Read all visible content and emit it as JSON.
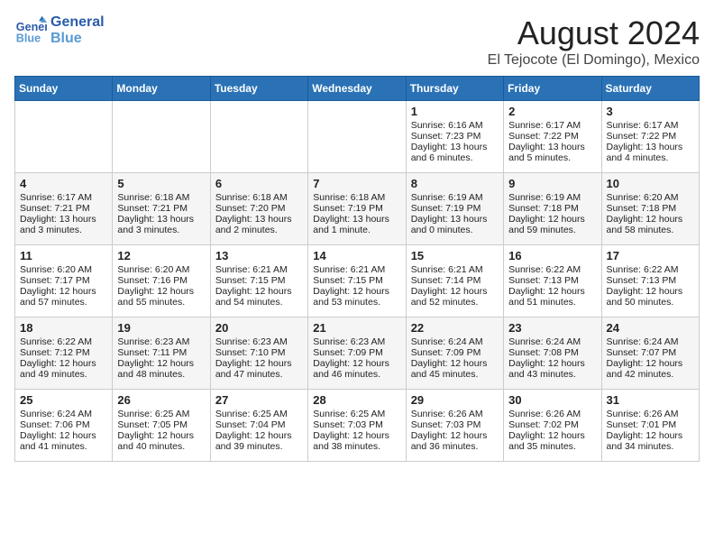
{
  "header": {
    "logo_line1": "General",
    "logo_line2": "Blue",
    "title": "August 2024",
    "subtitle": "El Tejocote (El Domingo), Mexico"
  },
  "days_of_week": [
    "Sunday",
    "Monday",
    "Tuesday",
    "Wednesday",
    "Thursday",
    "Friday",
    "Saturday"
  ],
  "weeks": [
    [
      {
        "day": "",
        "content": ""
      },
      {
        "day": "",
        "content": ""
      },
      {
        "day": "",
        "content": ""
      },
      {
        "day": "",
        "content": ""
      },
      {
        "day": "1",
        "content": "Sunrise: 6:16 AM\nSunset: 7:23 PM\nDaylight: 13 hours\nand 6 minutes."
      },
      {
        "day": "2",
        "content": "Sunrise: 6:17 AM\nSunset: 7:22 PM\nDaylight: 13 hours\nand 5 minutes."
      },
      {
        "day": "3",
        "content": "Sunrise: 6:17 AM\nSunset: 7:22 PM\nDaylight: 13 hours\nand 4 minutes."
      }
    ],
    [
      {
        "day": "4",
        "content": "Sunrise: 6:17 AM\nSunset: 7:21 PM\nDaylight: 13 hours\nand 3 minutes."
      },
      {
        "day": "5",
        "content": "Sunrise: 6:18 AM\nSunset: 7:21 PM\nDaylight: 13 hours\nand 3 minutes."
      },
      {
        "day": "6",
        "content": "Sunrise: 6:18 AM\nSunset: 7:20 PM\nDaylight: 13 hours\nand 2 minutes."
      },
      {
        "day": "7",
        "content": "Sunrise: 6:18 AM\nSunset: 7:19 PM\nDaylight: 13 hours\nand 1 minute."
      },
      {
        "day": "8",
        "content": "Sunrise: 6:19 AM\nSunset: 7:19 PM\nDaylight: 13 hours\nand 0 minutes."
      },
      {
        "day": "9",
        "content": "Sunrise: 6:19 AM\nSunset: 7:18 PM\nDaylight: 12 hours\nand 59 minutes."
      },
      {
        "day": "10",
        "content": "Sunrise: 6:20 AM\nSunset: 7:18 PM\nDaylight: 12 hours\nand 58 minutes."
      }
    ],
    [
      {
        "day": "11",
        "content": "Sunrise: 6:20 AM\nSunset: 7:17 PM\nDaylight: 12 hours\nand 57 minutes."
      },
      {
        "day": "12",
        "content": "Sunrise: 6:20 AM\nSunset: 7:16 PM\nDaylight: 12 hours\nand 55 minutes."
      },
      {
        "day": "13",
        "content": "Sunrise: 6:21 AM\nSunset: 7:15 PM\nDaylight: 12 hours\nand 54 minutes."
      },
      {
        "day": "14",
        "content": "Sunrise: 6:21 AM\nSunset: 7:15 PM\nDaylight: 12 hours\nand 53 minutes."
      },
      {
        "day": "15",
        "content": "Sunrise: 6:21 AM\nSunset: 7:14 PM\nDaylight: 12 hours\nand 52 minutes."
      },
      {
        "day": "16",
        "content": "Sunrise: 6:22 AM\nSunset: 7:13 PM\nDaylight: 12 hours\nand 51 minutes."
      },
      {
        "day": "17",
        "content": "Sunrise: 6:22 AM\nSunset: 7:13 PM\nDaylight: 12 hours\nand 50 minutes."
      }
    ],
    [
      {
        "day": "18",
        "content": "Sunrise: 6:22 AM\nSunset: 7:12 PM\nDaylight: 12 hours\nand 49 minutes."
      },
      {
        "day": "19",
        "content": "Sunrise: 6:23 AM\nSunset: 7:11 PM\nDaylight: 12 hours\nand 48 minutes."
      },
      {
        "day": "20",
        "content": "Sunrise: 6:23 AM\nSunset: 7:10 PM\nDaylight: 12 hours\nand 47 minutes."
      },
      {
        "day": "21",
        "content": "Sunrise: 6:23 AM\nSunset: 7:09 PM\nDaylight: 12 hours\nand 46 minutes."
      },
      {
        "day": "22",
        "content": "Sunrise: 6:24 AM\nSunset: 7:09 PM\nDaylight: 12 hours\nand 45 minutes."
      },
      {
        "day": "23",
        "content": "Sunrise: 6:24 AM\nSunset: 7:08 PM\nDaylight: 12 hours\nand 43 minutes."
      },
      {
        "day": "24",
        "content": "Sunrise: 6:24 AM\nSunset: 7:07 PM\nDaylight: 12 hours\nand 42 minutes."
      }
    ],
    [
      {
        "day": "25",
        "content": "Sunrise: 6:24 AM\nSunset: 7:06 PM\nDaylight: 12 hours\nand 41 minutes."
      },
      {
        "day": "26",
        "content": "Sunrise: 6:25 AM\nSunset: 7:05 PM\nDaylight: 12 hours\nand 40 minutes."
      },
      {
        "day": "27",
        "content": "Sunrise: 6:25 AM\nSunset: 7:04 PM\nDaylight: 12 hours\nand 39 minutes."
      },
      {
        "day": "28",
        "content": "Sunrise: 6:25 AM\nSunset: 7:03 PM\nDaylight: 12 hours\nand 38 minutes."
      },
      {
        "day": "29",
        "content": "Sunrise: 6:26 AM\nSunset: 7:03 PM\nDaylight: 12 hours\nand 36 minutes."
      },
      {
        "day": "30",
        "content": "Sunrise: 6:26 AM\nSunset: 7:02 PM\nDaylight: 12 hours\nand 35 minutes."
      },
      {
        "day": "31",
        "content": "Sunrise: 6:26 AM\nSunset: 7:01 PM\nDaylight: 12 hours\nand 34 minutes."
      }
    ]
  ]
}
